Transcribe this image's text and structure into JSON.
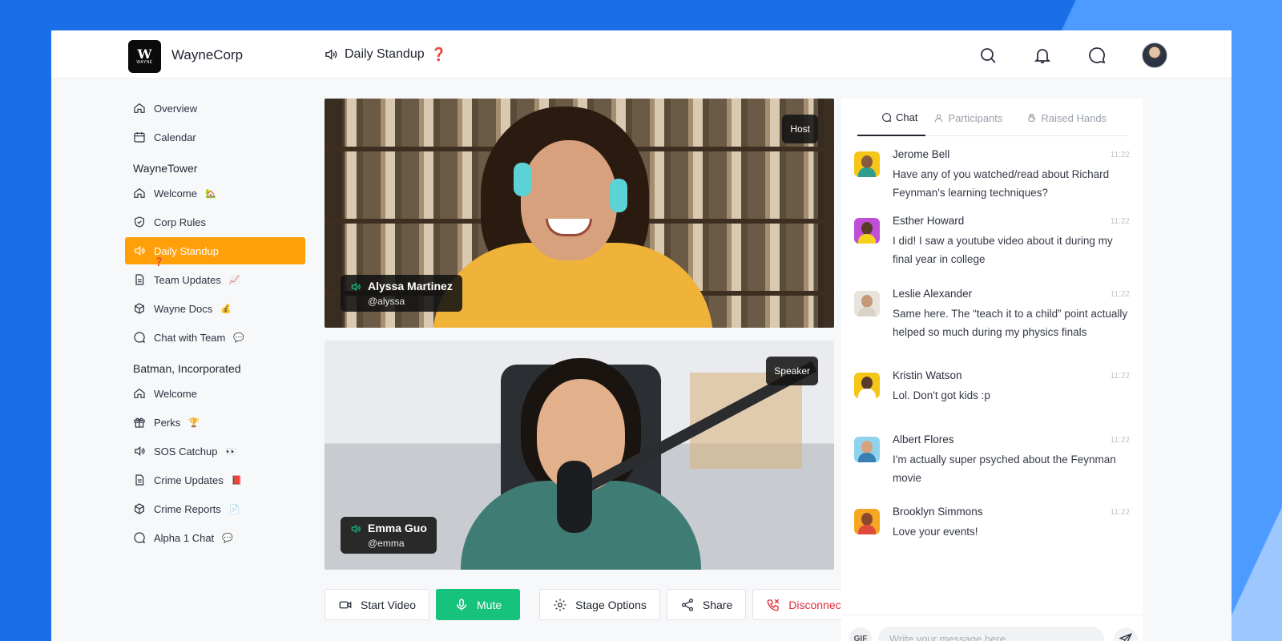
{
  "brand": {
    "name": "WayneCorp",
    "logo_text": "W",
    "logo_subtext": "WAYNE"
  },
  "header": {
    "room_title": "Daily Standup",
    "room_mark": "❓"
  },
  "sidebar": {
    "top_items": [
      {
        "label": "Overview",
        "icon": "home-icon"
      },
      {
        "label": "Calendar",
        "icon": "calendar-icon"
      }
    ],
    "sections": [
      {
        "title": "WayneTower",
        "items": [
          {
            "label": "Welcome",
            "emoji": "🏡",
            "icon": "home-icon"
          },
          {
            "label": "Corp Rules",
            "emoji": "",
            "icon": "shield-icon"
          },
          {
            "label": "Daily Standup",
            "emoji": "❓",
            "icon": "speaker-icon",
            "active": true
          },
          {
            "label": "Team Updates",
            "emoji": "📈",
            "icon": "document-icon"
          },
          {
            "label": "Wayne Docs",
            "emoji": "💰",
            "icon": "cube-icon"
          },
          {
            "label": "Chat with Team",
            "emoji": "💬",
            "icon": "chat-icon"
          }
        ]
      },
      {
        "title": "Batman, Incorporated",
        "items": [
          {
            "label": "Welcome",
            "emoji": "",
            "icon": "home-icon"
          },
          {
            "label": "Perks",
            "emoji": "🏆",
            "icon": "gift-icon"
          },
          {
            "label": "SOS Catchup",
            "emoji": "👀",
            "icon": "speaker-icon"
          },
          {
            "label": "Crime Updates",
            "emoji": "📕",
            "icon": "document-icon"
          },
          {
            "label": "Crime Reports",
            "emoji": "📄",
            "icon": "cube-icon"
          },
          {
            "label": "Alpha 1 Chat",
            "emoji": "💬",
            "icon": "chat-icon"
          }
        ]
      }
    ]
  },
  "videos": [
    {
      "role": "Host",
      "name": "Alyssa Martinez",
      "handle": "@alyssa"
    },
    {
      "role": "Speaker",
      "name": "Emma Guo",
      "handle": "@emma"
    }
  ],
  "controls": {
    "start_video": "Start Video",
    "mute": "Mute",
    "stage_options": "Stage Options",
    "share": "Share",
    "disconnect": "Disconnect"
  },
  "chat": {
    "tabs": [
      "Chat",
      "Participants",
      "Raised Hands"
    ],
    "messages": [
      {
        "sender": "Jerome Bell",
        "time": "11:22",
        "text": "Have any of you watched/read about Richard Feynman's learning techniques?"
      },
      {
        "sender": "Esther Howard",
        "time": "11:22",
        "text": "I did! I saw a youtube video about it during my final year in college"
      },
      {
        "sender": "Leslie Alexander",
        "time": "11:22",
        "text": "Same here. The “teach it to a child” point actually helped so much during my physics finals"
      },
      {
        "sender": "Kristin Watson",
        "time": "11:22",
        "text": "Lol. Don't got kids :p"
      },
      {
        "sender": "Albert Flores",
        "time": "11:22",
        "text": "I'm actually super psyched about the Feynman movie"
      },
      {
        "sender": "Brooklyn Simmons",
        "time": "11:22",
        "text": "Love your events!"
      }
    ],
    "gif_label": "GIF",
    "input_placeholder": "Write your message here..."
  },
  "colors": {
    "accent_orange": "#ff9f0a",
    "mute_green": "#17c27d",
    "disconnect_red": "#e52a3a"
  }
}
